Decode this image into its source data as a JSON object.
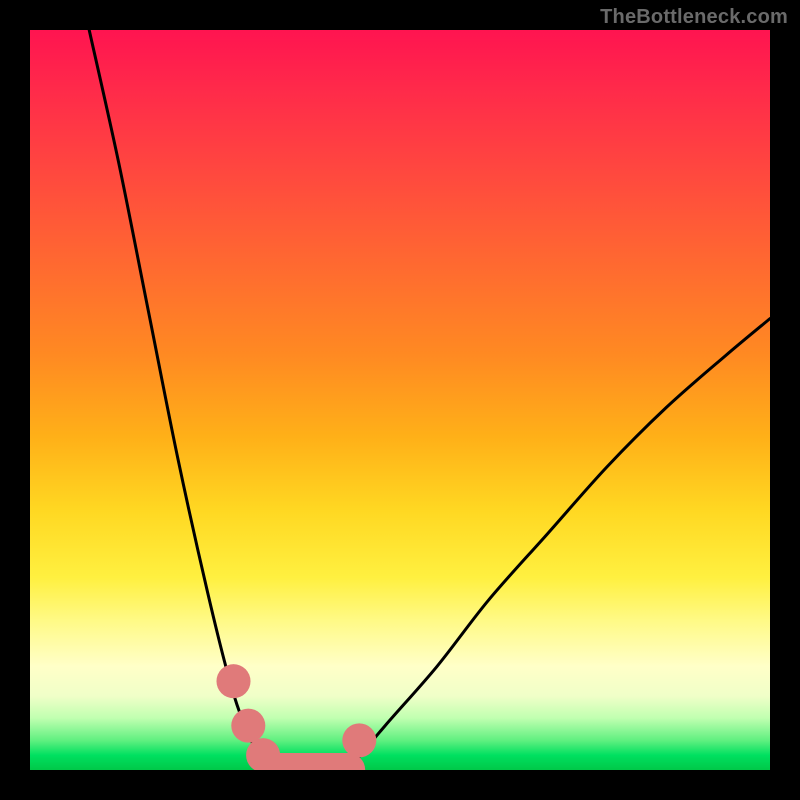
{
  "watermark": "TheBottleneck.com",
  "chart_data": {
    "type": "line",
    "title": "",
    "xlabel": "",
    "ylabel": "",
    "xlim": [
      0,
      100
    ],
    "ylim": [
      0,
      100
    ],
    "grid": false,
    "series": [
      {
        "name": "left-curve",
        "x": [
          8,
          12,
          16,
          20,
          24,
          27,
          29,
          31,
          33
        ],
        "y": [
          100,
          82,
          62,
          42,
          24,
          12,
          6,
          2,
          0
        ]
      },
      {
        "name": "valley-floor",
        "x": [
          33,
          35,
          38,
          41,
          43
        ],
        "y": [
          0,
          0,
          0,
          0,
          0
        ]
      },
      {
        "name": "right-curve",
        "x": [
          43,
          48,
          55,
          62,
          70,
          78,
          86,
          94,
          100
        ],
        "y": [
          0,
          6,
          14,
          23,
          32,
          41,
          49,
          56,
          61
        ]
      }
    ],
    "markers": [
      {
        "name": "left-marker-1",
        "x": 27.5,
        "y": 12,
        "color": "#e07a7a",
        "r": 2.3
      },
      {
        "name": "left-marker-2",
        "x": 29.5,
        "y": 6,
        "color": "#e07a7a",
        "r": 2.3
      },
      {
        "name": "left-marker-3",
        "x": 31.5,
        "y": 2,
        "color": "#e07a7a",
        "r": 2.3
      },
      {
        "name": "right-marker-1",
        "x": 44.5,
        "y": 4,
        "color": "#e07a7a",
        "r": 2.3
      },
      {
        "name": "valley-bar",
        "x0": 33,
        "x1": 43,
        "y": 0,
        "color": "#e07a7a",
        "thickness": 4.6
      }
    ],
    "background_gradient": {
      "stops": [
        {
          "pos": 0.0,
          "color": "#ff1450"
        },
        {
          "pos": 0.32,
          "color": "#ff6a30"
        },
        {
          "pos": 0.65,
          "color": "#ffd822"
        },
        {
          "pos": 0.86,
          "color": "#ffffc8"
        },
        {
          "pos": 0.96,
          "color": "#60f080"
        },
        {
          "pos": 1.0,
          "color": "#00c848"
        }
      ]
    }
  }
}
